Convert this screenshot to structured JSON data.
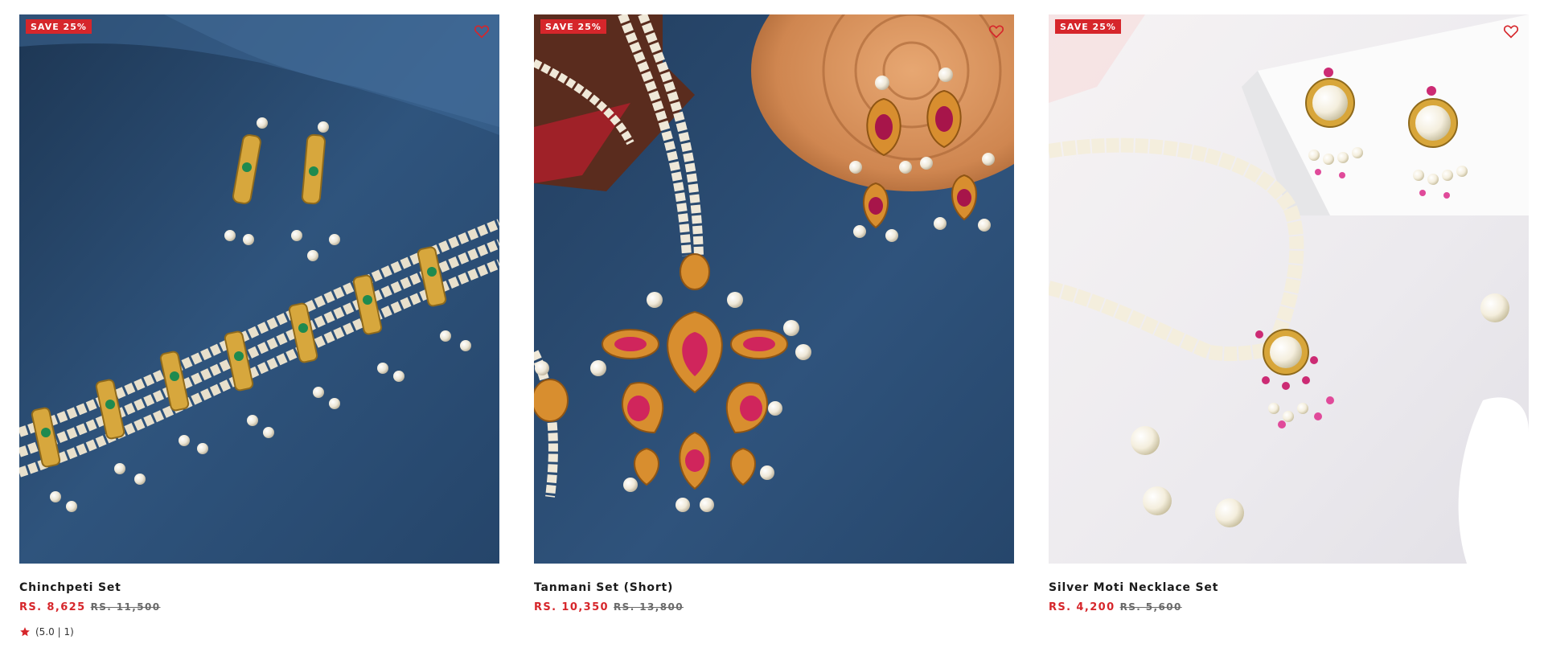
{
  "products": [
    {
      "badge": "SAVE 25%",
      "title": "Chinchpeti Set",
      "price_sale": "RS. 8,625",
      "price_old": "RS. 11,500",
      "rating_text": "(5.0 | 1)",
      "rating_value": 5.0,
      "rating_count": 1
    },
    {
      "badge": "SAVE 25%",
      "title": "Tanmani Set (Short)",
      "price_sale": "RS. 10,350",
      "price_old": "RS. 13,800"
    },
    {
      "badge": "SAVE 25%",
      "title": "Silver Moti Necklace Set",
      "price_sale": "RS. 4,200",
      "price_old": "RS. 5,600"
    }
  ],
  "icons": {
    "wishlist": "heart-outline-icon",
    "rating": "star-icon"
  },
  "colors": {
    "accent": "#d6262b",
    "title": "#1b1b1b",
    "old_price": "#6a6a6a"
  }
}
